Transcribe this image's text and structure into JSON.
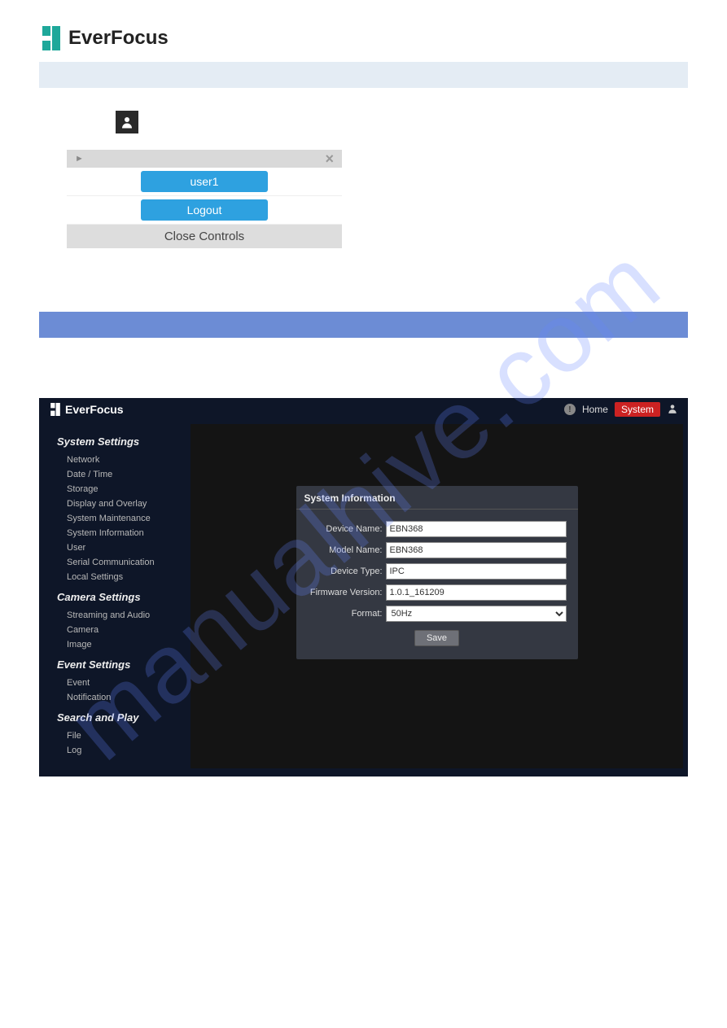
{
  "brand": "EverFocus",
  "watermark": "manualhive.com",
  "userControls": {
    "buttons": [
      "user1",
      "Logout"
    ],
    "footer": "Close Controls"
  },
  "app": {
    "brand": "EverFocus",
    "nav": {
      "home": "Home",
      "system": "System"
    },
    "sidebar": {
      "groups": [
        {
          "heading": "System Settings",
          "items": [
            "Network",
            "Date / Time",
            "Storage",
            "Display and Overlay",
            "System Maintenance",
            "System Information",
            "User",
            "Serial Communication",
            "Local Settings"
          ]
        },
        {
          "heading": "Camera Settings",
          "items": [
            "Streaming and Audio",
            "Camera",
            "Image"
          ]
        },
        {
          "heading": "Event Settings",
          "items": [
            "Event",
            "Notification"
          ]
        },
        {
          "heading": "Search and Play",
          "items": [
            "File",
            "Log"
          ]
        }
      ]
    },
    "panel": {
      "title": "System Information",
      "fields": {
        "deviceName": {
          "label": "Device Name:",
          "value": "EBN368"
        },
        "modelName": {
          "label": "Model Name:",
          "value": "EBN368"
        },
        "deviceType": {
          "label": "Device Type:",
          "value": "IPC"
        },
        "firmwareVersion": {
          "label": "Firmware Version:",
          "value": "1.0.1_161209"
        },
        "format": {
          "label": "Format:",
          "value": "50Hz"
        }
      },
      "save": "Save"
    }
  }
}
